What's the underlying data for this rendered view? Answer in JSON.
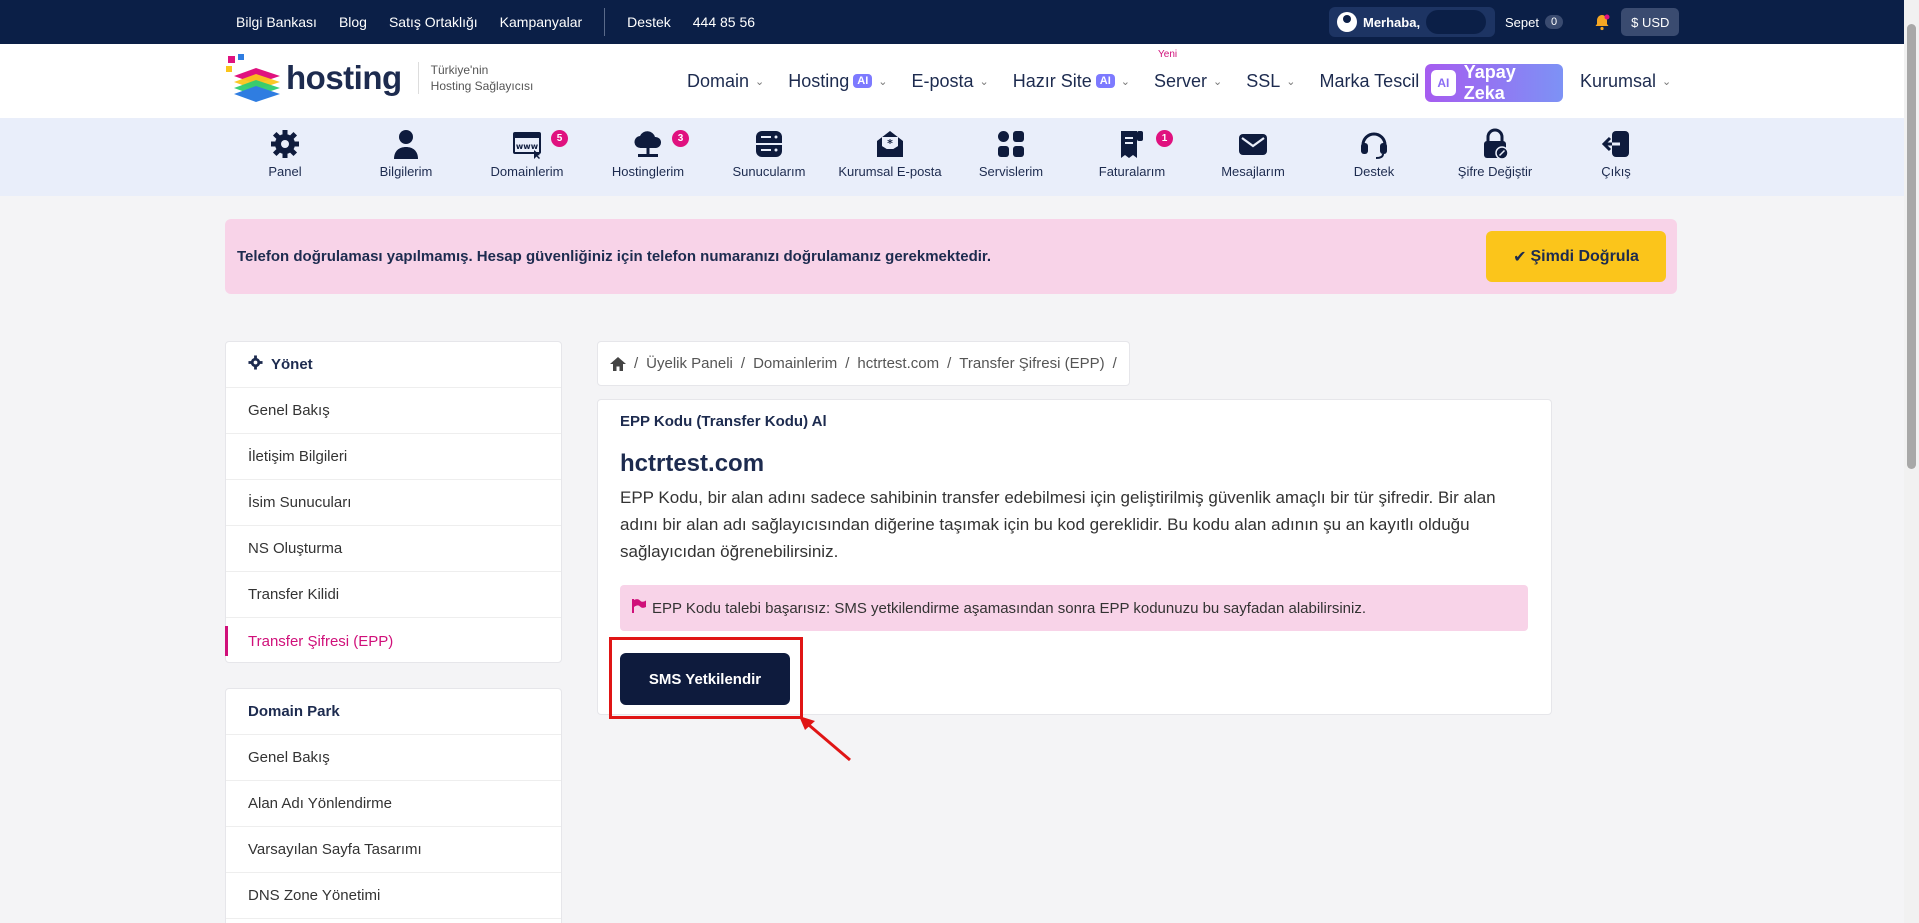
{
  "topbar": {
    "links": [
      "Bilgi Bankası",
      "Blog",
      "Satış Ortaklığı",
      "Kampanyalar"
    ],
    "support": "Destek",
    "phone": "444 85 56",
    "greeting": "Merhaba,",
    "cart_label": "Sepet",
    "cart_count": "0",
    "currency": "$ USD"
  },
  "header": {
    "logo_text": "hosting",
    "tagline_line1": "Türkiye'nin",
    "tagline_line2": "Hosting Sağlayıcısı",
    "nav": [
      {
        "label": "Domain",
        "ai": false,
        "new": ""
      },
      {
        "label": "Hosting",
        "ai": true,
        "new": ""
      },
      {
        "label": "E-posta",
        "ai": false,
        "new": ""
      },
      {
        "label": "Hazır Site",
        "ai": true,
        "new": ""
      },
      {
        "label": "Server",
        "ai": false,
        "new": "Yeni"
      },
      {
        "label": "SSL",
        "ai": false,
        "new": ""
      },
      {
        "label": "Marka Tescil",
        "ai": false,
        "new": ""
      }
    ],
    "ai_badge": "AI",
    "yapay_zeka": "Yapay Zeka",
    "kurumsal": "Kurumsal"
  },
  "iconbar": [
    {
      "label": "Panel",
      "count": ""
    },
    {
      "label": "Bilgilerim",
      "count": ""
    },
    {
      "label": "Domainlerim",
      "count": "5"
    },
    {
      "label": "Hostinglerim",
      "count": "3"
    },
    {
      "label": "Sunucularım",
      "count": ""
    },
    {
      "label": "Kurumsal E-posta",
      "count": ""
    },
    {
      "label": "Servislerim",
      "count": ""
    },
    {
      "label": "Faturalarım",
      "count": "1"
    },
    {
      "label": "Mesajlarım",
      "count": ""
    },
    {
      "label": "Destek",
      "count": ""
    },
    {
      "label": "Şifre Değiştir",
      "count": ""
    },
    {
      "label": "Çıkış",
      "count": ""
    }
  ],
  "alert": {
    "message": "Telefon doğrulaması yapılmamış. Hesap güvenliğiniz için telefon numaranızı doğrulamanız gerekmektedir.",
    "button": "Şimdi Doğrula"
  },
  "sidebar": {
    "manage_title": "Yönet",
    "manage_items": [
      "Genel Bakış",
      "İletişim Bilgileri",
      "İsim Sunucuları",
      "NS Oluşturma",
      "Transfer Kilidi",
      "Transfer Şifresi (EPP)"
    ],
    "park_title": "Domain Park",
    "park_items": [
      "Genel Bakış",
      "Alan Adı Yönlendirme",
      "Varsayılan Sayfa Tasarımı",
      "DNS Zone Yönetimi"
    ]
  },
  "breadcrumb": [
    "Üyelik Paneli",
    "Domainlerim",
    "hctrtest.com",
    "Transfer Şifresi (EPP)"
  ],
  "main": {
    "title": "EPP Kodu (Transfer Kodu) Al",
    "domain": "hctrtest.com",
    "description": "EPP Kodu, bir alan adını sadece sahibinin transfer edebilmesi için geliştirilmiş güvenlik amaçlı bir tür şifredir. Bir alan adını bir alan adı sağlayıcısından diğerine taşımak için bu kod gereklidir. Bu kodu alan adının şu an kayıtlı olduğu sağlayıcıdan öğrenebilirsiniz.",
    "warning": "EPP Kodu talebi başarısız: SMS yetkilendirme aşamasından sonra EPP kodunuzu bu sayfadan alabilirsiniz.",
    "sms_button": "SMS Yetkilendir"
  },
  "colors": {
    "topbar": "#0b1f47",
    "accent_pink": "#d0107a",
    "alert_bg": "#f8d3e8",
    "verify_yellow": "#fbc51b",
    "button_navy": "#0e1b3d",
    "highlight_red": "#e01515"
  }
}
